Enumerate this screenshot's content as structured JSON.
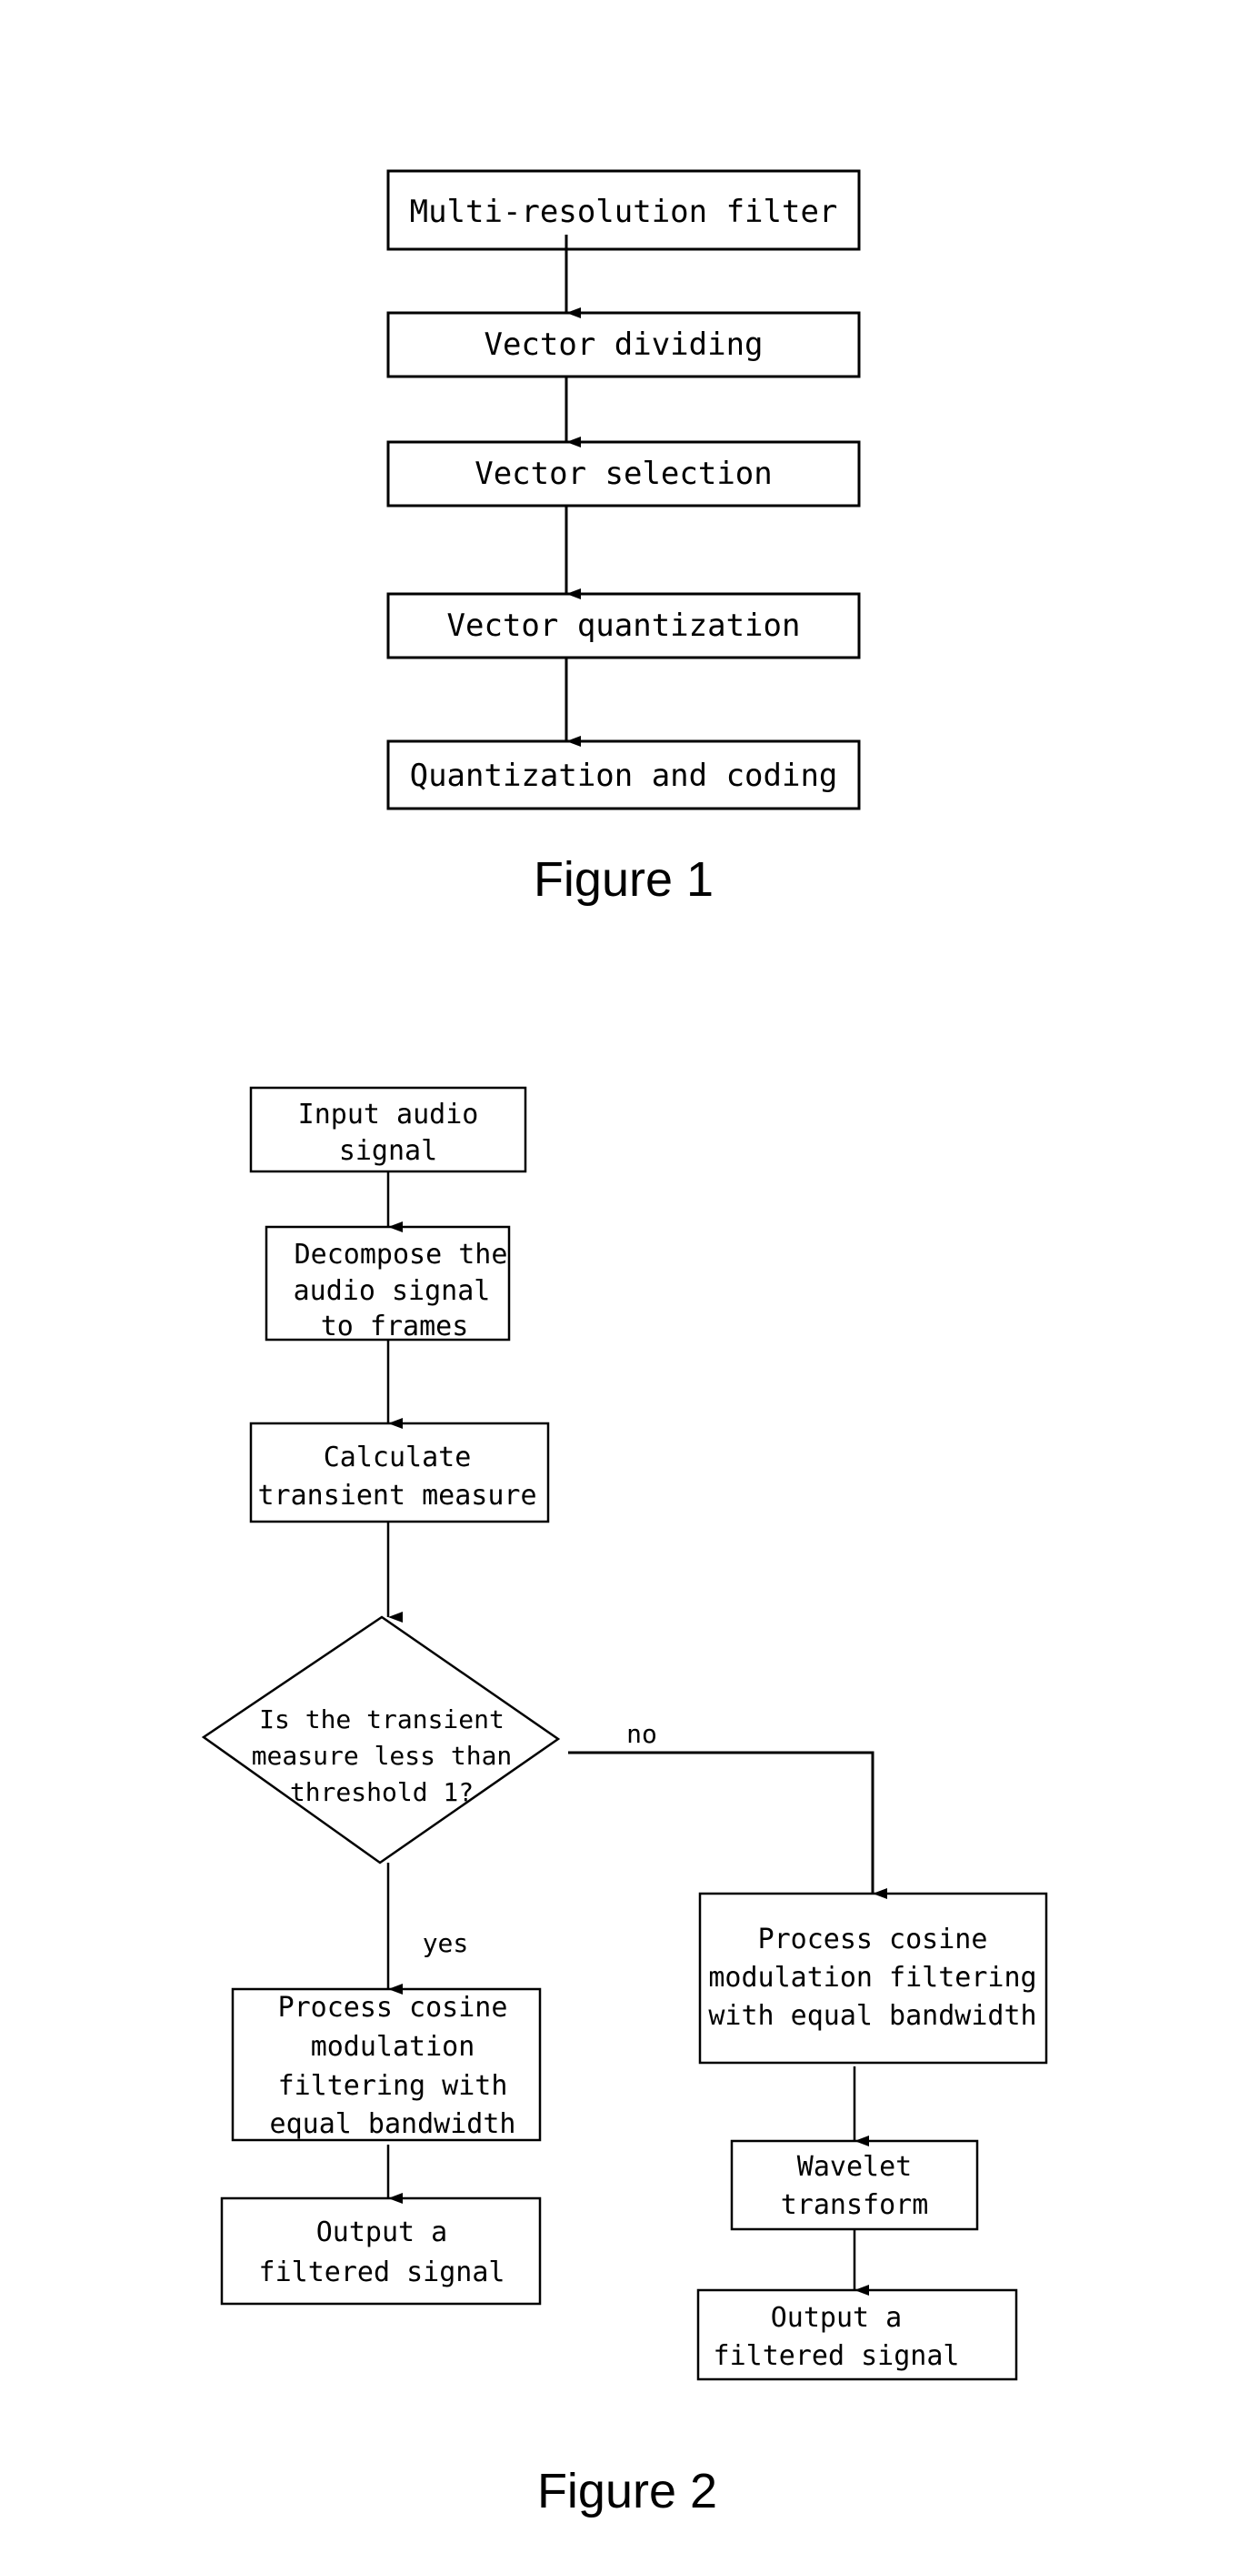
{
  "figure1": {
    "caption": "Figure 1",
    "nodes": [
      {
        "id": "multi_resolution_filter",
        "label": [
          "Multi-resolution filter"
        ]
      },
      {
        "id": "vector_dividing",
        "label": [
          "Vector dividing"
        ]
      },
      {
        "id": "vector_selection",
        "label": [
          "Vector selection"
        ]
      },
      {
        "id": "vector_quantization",
        "label": [
          "Vector quantization"
        ]
      },
      {
        "id": "quantization_and_coding",
        "label": [
          "Quantization and coding"
        ]
      }
    ],
    "edges": [
      {
        "from": "multi_resolution_filter",
        "to": "vector_dividing"
      },
      {
        "from": "vector_dividing",
        "to": "vector_selection"
      },
      {
        "from": "vector_selection",
        "to": "vector_quantization"
      },
      {
        "from": "vector_quantization",
        "to": "quantization_and_coding"
      }
    ]
  },
  "figure2": {
    "caption": "Figure 2",
    "nodes": [
      {
        "id": "input_audio_signal",
        "type": "process",
        "label": [
          "Input audio",
          "signal"
        ]
      },
      {
        "id": "decompose_frames",
        "type": "process",
        "label": [
          "Decompose the",
          "audio signal",
          "to frames"
        ]
      },
      {
        "id": "calculate_transient",
        "type": "process",
        "label": [
          "Calculate",
          "transient measure"
        ]
      },
      {
        "id": "transient_decision",
        "type": "decision",
        "label": [
          "Is the transient",
          "measure less than",
          "threshold 1?"
        ]
      },
      {
        "id": "cosine_filter_yes",
        "type": "process",
        "label": [
          "Process cosine",
          "modulation",
          "filtering with",
          "equal bandwidth"
        ]
      },
      {
        "id": "output_yes",
        "type": "process",
        "label": [
          "Output a",
          "filtered signal"
        ]
      },
      {
        "id": "cosine_filter_no",
        "type": "process",
        "label": [
          "Process cosine",
          "modulation filtering",
          "with equal bandwidth"
        ]
      },
      {
        "id": "wavelet_transform",
        "type": "process",
        "label": [
          "Wavelet",
          "transform"
        ]
      },
      {
        "id": "output_no",
        "type": "process",
        "label": [
          "Output a",
          "filtered signal"
        ]
      }
    ],
    "edges": [
      {
        "from": "input_audio_signal",
        "to": "decompose_frames",
        "label": ""
      },
      {
        "from": "decompose_frames",
        "to": "calculate_transient",
        "label": ""
      },
      {
        "from": "calculate_transient",
        "to": "transient_decision",
        "label": ""
      },
      {
        "from": "transient_decision",
        "to": "cosine_filter_yes",
        "label": "yes"
      },
      {
        "from": "transient_decision",
        "to": "cosine_filter_no",
        "label": "no"
      },
      {
        "from": "cosine_filter_yes",
        "to": "output_yes",
        "label": ""
      },
      {
        "from": "cosine_filter_no",
        "to": "wavelet_transform",
        "label": ""
      },
      {
        "from": "wavelet_transform",
        "to": "output_no",
        "label": ""
      }
    ]
  }
}
